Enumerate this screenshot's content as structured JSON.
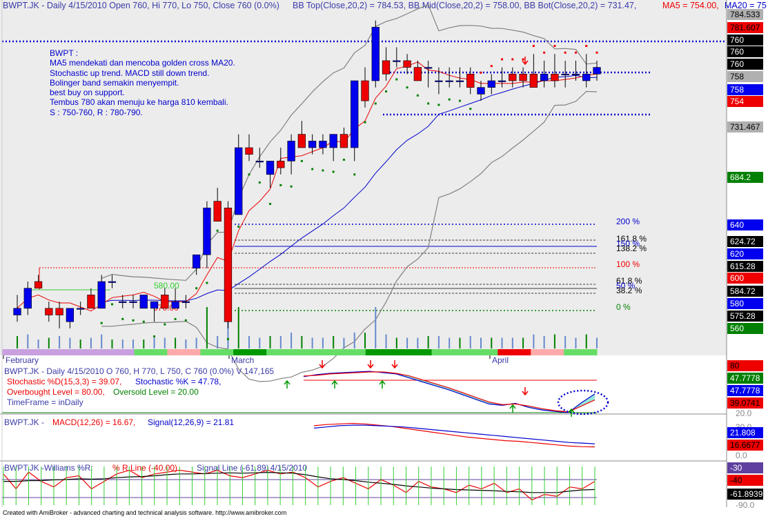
{
  "colors": {
    "up": "#0000ee",
    "down": "#ee0000",
    "bg": "#ececec",
    "green": "#008000",
    "grey": "#808080"
  },
  "header": {
    "ticker": "BWPT.JK - Daily 4/15/2010 Open 760, Hi 770, Lo 750, Close 760 (0.0%)",
    "bb": "BB Top(Close,20,2) = 784.53, BB Mid(Close,20,2) = 758.00, BB Bot(Close,20,2) = 731.47,",
    "ma5": "MA5 = 754.00,",
    "ma20": "MA20 = 75"
  },
  "annotation": {
    "lines": [
      "BWPT :",
      "MA5 mendekati dan mencoba golden cross MA20.",
      "Stochastic up trend. MACD still down trend.",
      "Bolinger band semakin menyempit.",
      "best buy on support.",
      "Tembus 780 akan menuju ke harga 810 kembali.",
      "S  : 750-760, R : 780-790."
    ]
  },
  "chart_labels": {
    "label_580": "580.00",
    "label_570": "570.00"
  },
  "months": [
    "February",
    "March",
    "April"
  ],
  "footer": "Created with AmiBroker - advanced charting and technical analysis software. http://www.amibroker.com",
  "chart_data": [
    {
      "type": "candlestick",
      "ylim": [
        540,
        790
      ],
      "candles": [
        {
          "o": 565,
          "h": 580,
          "l": 560,
          "c": 570
        },
        {
          "o": 570,
          "h": 590,
          "l": 565,
          "c": 585
        },
        {
          "o": 590,
          "h": 595,
          "l": 585,
          "c": 585
        },
        {
          "o": 570,
          "h": 575,
          "l": 560,
          "c": 565
        },
        {
          "o": 570,
          "h": 575,
          "l": 555,
          "c": 565
        },
        {
          "o": 560,
          "h": 570,
          "l": 555,
          "c": 570
        },
        {
          "o": 570,
          "h": 575,
          "l": 565,
          "c": 570
        },
        {
          "o": 580,
          "h": 585,
          "l": 570,
          "c": 570
        },
        {
          "o": 570,
          "h": 595,
          "l": 570,
          "c": 590
        },
        {
          "o": 590,
          "h": 595,
          "l": 585,
          "c": 590
        },
        {
          "o": 575,
          "h": 580,
          "l": 570,
          "c": 575
        },
        {
          "o": 575,
          "h": 580,
          "l": 570,
          "c": 575
        },
        {
          "o": 570,
          "h": 580,
          "l": 570,
          "c": 580
        },
        {
          "o": 570,
          "h": 575,
          "l": 560,
          "c": 575
        },
        {
          "o": 580,
          "h": 585,
          "l": 570,
          "c": 570
        },
        {
          "o": 570,
          "h": 585,
          "l": 570,
          "c": 575
        },
        {
          "o": 575,
          "h": 580,
          "l": 570,
          "c": 575
        },
        {
          "o": 600,
          "h": 610,
          "l": 595,
          "c": 610
        },
        {
          "o": 610,
          "h": 650,
          "l": 600,
          "c": 645
        },
        {
          "o": 650,
          "h": 660,
          "l": 640,
          "c": 635
        },
        {
          "o": 645,
          "h": 650,
          "l": 555,
          "c": 560
        },
        {
          "o": 640,
          "h": 700,
          "l": 640,
          "c": 690
        },
        {
          "o": 690,
          "h": 700,
          "l": 680,
          "c": 685
        },
        {
          "o": 680,
          "h": 690,
          "l": 675,
          "c": 680
        },
        {
          "o": 670,
          "h": 680,
          "l": 660,
          "c": 680
        },
        {
          "o": 680,
          "h": 690,
          "l": 670,
          "c": 675
        },
        {
          "o": 680,
          "h": 700,
          "l": 670,
          "c": 695
        },
        {
          "o": 700,
          "h": 710,
          "l": 690,
          "c": 690
        },
        {
          "o": 690,
          "h": 700,
          "l": 685,
          "c": 695
        },
        {
          "o": 690,
          "h": 700,
          "l": 685,
          "c": 695
        },
        {
          "o": 690,
          "h": 700,
          "l": 680,
          "c": 700
        },
        {
          "o": 700,
          "h": 705,
          "l": 690,
          "c": 690
        },
        {
          "o": 690,
          "h": 710,
          "l": 680,
          "c": 740
        },
        {
          "o": 740,
          "h": 750,
          "l": 720,
          "c": 725
        },
        {
          "o": 740,
          "h": 785,
          "l": 735,
          "c": 780
        },
        {
          "o": 755,
          "h": 765,
          "l": 740,
          "c": 745
        },
        {
          "o": 755,
          "h": 765,
          "l": 750,
          "c": 755
        },
        {
          "o": 755,
          "h": 760,
          "l": 745,
          "c": 750
        },
        {
          "o": 750,
          "h": 755,
          "l": 740,
          "c": 740
        },
        {
          "o": 750,
          "h": 755,
          "l": 735,
          "c": 750
        },
        {
          "o": 740,
          "h": 750,
          "l": 730,
          "c": 740
        },
        {
          "o": 740,
          "h": 750,
          "l": 735,
          "c": 740
        },
        {
          "o": 740,
          "h": 750,
          "l": 735,
          "c": 740
        },
        {
          "o": 745,
          "h": 750,
          "l": 730,
          "c": 735
        },
        {
          "o": 730,
          "h": 740,
          "l": 725,
          "c": 735
        },
        {
          "o": 735,
          "h": 745,
          "l": 730,
          "c": 740
        },
        {
          "o": 740,
          "h": 750,
          "l": 735,
          "c": 740
        },
        {
          "o": 745,
          "h": 750,
          "l": 735,
          "c": 740
        },
        {
          "o": 745,
          "h": 750,
          "l": 735,
          "c": 740
        },
        {
          "o": 745,
          "h": 760,
          "l": 735,
          "c": 735
        },
        {
          "o": 740,
          "h": 755,
          "l": 735,
          "c": 745
        },
        {
          "o": 745,
          "h": 760,
          "l": 735,
          "c": 740
        },
        {
          "o": 745,
          "h": 755,
          "l": 735,
          "c": 745
        },
        {
          "o": 745,
          "h": 755,
          "l": 740,
          "c": 745
        },
        {
          "o": 740,
          "h": 760,
          "l": 735,
          "c": 745
        },
        {
          "o": 745,
          "h": 755,
          "l": 740,
          "c": 750
        }
      ],
      "fib_levels": [
        {
          "label": "200 %",
          "value": 640
        },
        {
          "label": "161.8 %",
          "value": 630
        },
        {
          "label": "150 %",
          "value": 627
        },
        {
          "label": "138.2 %",
          "value": 624
        },
        {
          "label": "100 %",
          "value": 615
        },
        {
          "label": "61.8 %",
          "value": 605
        },
        {
          "label": "50 %",
          "value": 602
        },
        {
          "label": "38.2 %",
          "value": 599
        },
        {
          "label": "0 %",
          "value": 590
        }
      ],
      "price_labels": [
        {
          "text": "784.533",
          "bg": "#b0b0b0",
          "fg": "#000"
        },
        {
          "text": "781.607",
          "bg": "#ee0000",
          "fg": "#000"
        },
        {
          "text": "760",
          "bg": "#000000",
          "fg": "#fff"
        },
        {
          "text": "760",
          "bg": "#000000",
          "fg": "#fff"
        },
        {
          "text": "760",
          "bg": "#000000",
          "fg": "#fff"
        },
        {
          "text": "758",
          "bg": "#b0b0b0",
          "fg": "#000"
        },
        {
          "text": "758",
          "bg": "#0000ee",
          "fg": "#fff"
        },
        {
          "text": "754",
          "bg": "#ee0000",
          "fg": "#fff"
        },
        {
          "text": "731.467",
          "bg": "#b0b0b0",
          "fg": "#000"
        },
        {
          "text": "684.2",
          "bg": "#008000",
          "fg": "#fff"
        },
        {
          "text": "640",
          "bg": "#0000ee",
          "fg": "#fff"
        },
        {
          "text": "624.72",
          "bg": "#000000",
          "fg": "#fff"
        },
        {
          "text": "620",
          "bg": "#0000ee",
          "fg": "#fff"
        },
        {
          "text": "615.28",
          "bg": "#000000",
          "fg": "#fff"
        },
        {
          "text": "600",
          "bg": "#ee0000",
          "fg": "#fff"
        },
        {
          "text": "584.72",
          "bg": "#000000",
          "fg": "#fff"
        },
        {
          "text": "580",
          "bg": "#0000ee",
          "fg": "#fff"
        },
        {
          "text": "575.28",
          "bg": "#000000",
          "fg": "#fff"
        },
        {
          "text": "560",
          "bg": "#008000",
          "fg": "#fff"
        }
      ]
    },
    {
      "type": "line",
      "title": "BWPT.JK - Daily 4/15/2010 O 760, H 770, L 750, C 760 (0.0%) V 147,165",
      "legend": [
        "Stochastic %D(15,3,3) = 39.07,",
        "Stochastic %K = 47.78,",
        "Overbought Level = 80.00,",
        "Oversold Level = 20.00",
        "TimeFrame = inDaily"
      ],
      "ylim": [
        20,
        80
      ],
      "overbought": 80,
      "oversold": 20,
      "series": [
        {
          "name": "Stochastic %K",
          "values": [
            74,
            77,
            79,
            80,
            81,
            82,
            80,
            78,
            72,
            66,
            60,
            54,
            47,
            40,
            33,
            31,
            34,
            28,
            24,
            22,
            20,
            35,
            48
          ]
        },
        {
          "name": "Stochastic %D",
          "values": [
            75,
            76,
            78,
            79,
            80,
            81,
            81,
            79,
            75,
            69,
            63,
            57,
            50,
            43,
            36,
            32,
            33,
            30,
            26,
            23,
            21,
            30,
            39
          ]
        }
      ],
      "axis_labels": [
        {
          "text": "80",
          "bg": "#ee0000",
          "fg": "#000"
        },
        {
          "text": "47.7778",
          "bg": "#008000",
          "fg": "#fff"
        },
        {
          "text": "47.7778",
          "bg": "#0000ee",
          "fg": "#fff"
        },
        {
          "text": "39.0741",
          "bg": "#ee0000",
          "fg": "#000"
        },
        {
          "text": "20.0",
          "bg": "none",
          "fg": "#888"
        }
      ]
    },
    {
      "type": "line",
      "title": "BWPT.JK - ",
      "legend": [
        "MACD(12,26) = 16.67,",
        "Signal(12,26,9) = 21.81"
      ],
      "ylim": [
        0,
        60
      ],
      "series": [
        {
          "name": "MACD",
          "values": [
            52,
            54,
            55,
            56,
            55,
            53,
            51,
            48,
            45,
            42,
            39,
            36,
            33,
            31,
            29,
            27,
            26,
            24,
            22,
            20,
            18,
            17,
            16.67
          ]
        },
        {
          "name": "Signal",
          "values": [
            48,
            50,
            52,
            53,
            53,
            52,
            51,
            50,
            48,
            46,
            44,
            42,
            40,
            38,
            36,
            34,
            32,
            30,
            28,
            26,
            24,
            23,
            21.81
          ]
        }
      ],
      "axis_labels": [
        {
          "text": "30.0",
          "bg": "none",
          "fg": "#888"
        },
        {
          "text": "21.808",
          "bg": "#0000ee",
          "fg": "#fff"
        },
        {
          "text": "16.6677",
          "bg": "#ee0000",
          "fg": "#000"
        },
        {
          "text": "0.0",
          "bg": "none",
          "fg": "#888"
        }
      ]
    },
    {
      "type": "line",
      "title": "BWPT.JK -Williams %R:",
      "legend": [
        "% R Line (-40.00)",
        "Signal Line (-61.89)",
        ", 4/15/2010"
      ],
      "ylim": [
        -100,
        0
      ],
      "series": [
        {
          "name": "% R Line",
          "values": [
            -20,
            -60,
            -15,
            -40,
            -55,
            -30,
            -25,
            -60,
            -40,
            -20,
            -10,
            -30,
            -20,
            -15,
            -10,
            -15,
            -20,
            -10,
            -25,
            -30,
            -20,
            -10,
            -20,
            -15,
            -30,
            -55,
            -40,
            -30,
            -45,
            -60,
            -35,
            -50,
            -70,
            -40,
            -55,
            -60,
            -70,
            -50,
            -60,
            -45,
            -70,
            -60,
            -90,
            -75,
            -80,
            -55,
            -60,
            -40
          ]
        },
        {
          "name": "Signal Line",
          "values": [
            -40,
            -40,
            -38,
            -38,
            -36,
            -35,
            -33,
            -34,
            -33,
            -30,
            -28,
            -27,
            -25,
            -22,
            -20,
            -20,
            -19,
            -18,
            -17,
            -18,
            -17,
            -16,
            -17,
            -18,
            -22,
            -28,
            -33,
            -35,
            -38,
            -42,
            -45,
            -48,
            -52,
            -55,
            -58,
            -60,
            -62,
            -63,
            -64,
            -65,
            -67,
            -68,
            -70,
            -70,
            -70,
            -66,
            -63,
            -61.89
          ]
        }
      ],
      "axis_labels": [
        {
          "text": "-30",
          "bg": "#5f3f9f",
          "fg": "#fff"
        },
        {
          "text": "-30.0",
          "bg": "none",
          "fg": "#888"
        },
        {
          "text": "-40",
          "bg": "#ee0000",
          "fg": "#000"
        },
        {
          "text": "-61.8939",
          "bg": "#000000",
          "fg": "#fff"
        },
        {
          "text": "-90.0",
          "bg": "none",
          "fg": "#888"
        }
      ]
    }
  ]
}
